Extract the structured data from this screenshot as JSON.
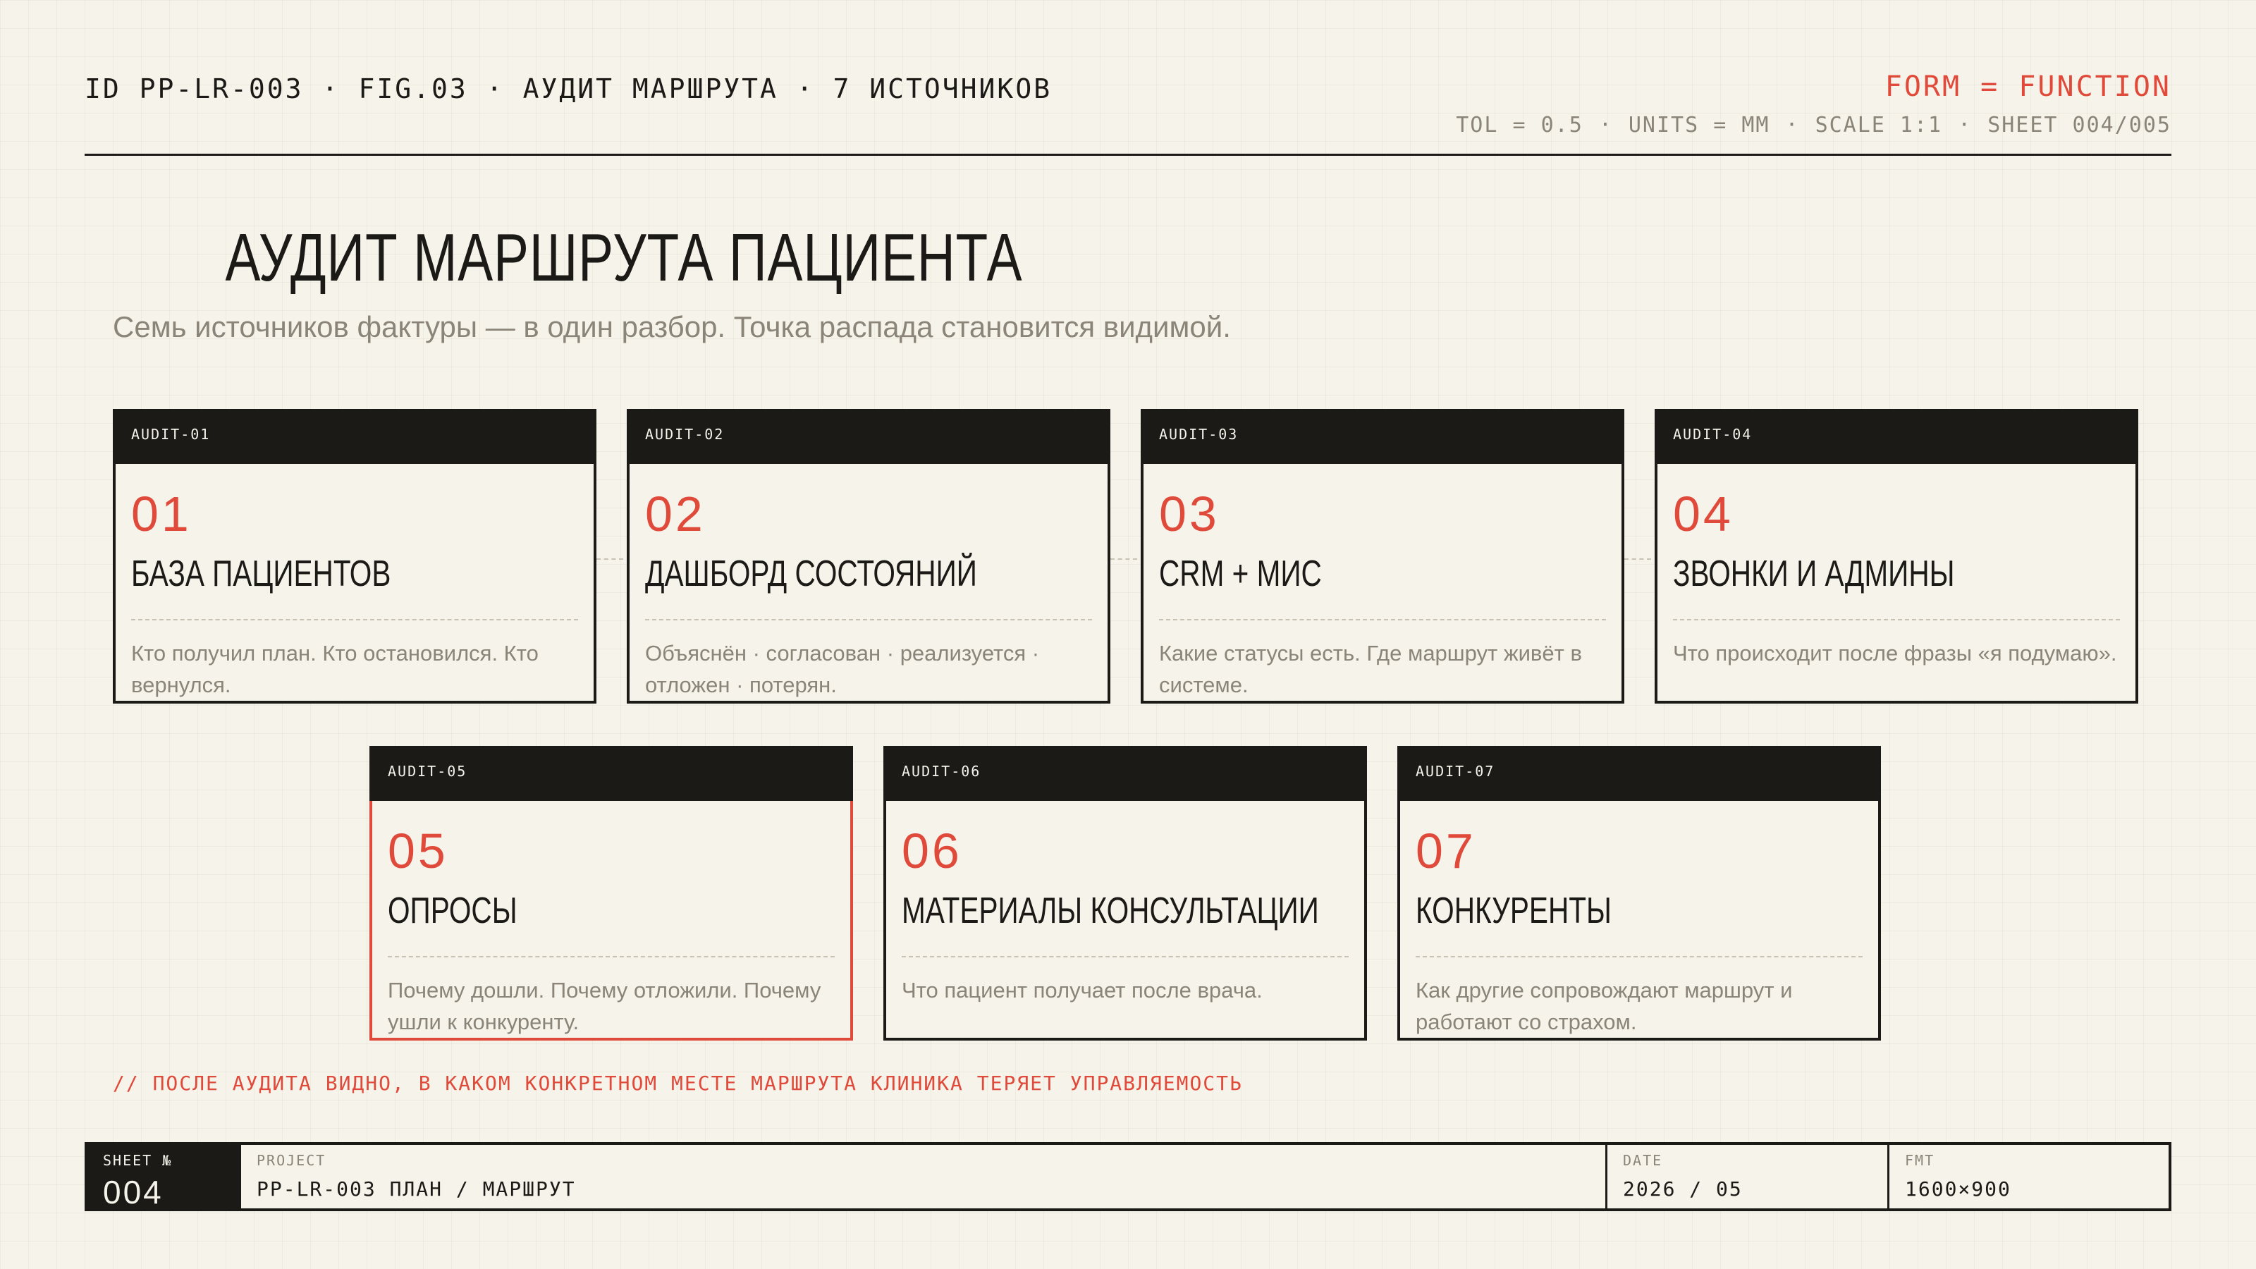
{
  "header": {
    "id": "ID PP-LR-003",
    "fig": "FIG.03",
    "caption": "АУДИТ МАРШРУТА · 7 ИСТОЧНИКОВ",
    "separator": "·",
    "form_function": "FORM = FUNCTION",
    "tol": "TOL = 0.5",
    "units": "UNITS = MM",
    "scale": "SCALE 1:1",
    "sheet": "SHEET 004/005"
  },
  "title": "АУДИТ МАРШРУТА ПАЦИЕНТА",
  "subtitle": "Семь источников фактуры — в один разбор. Точка распада становится видимой.",
  "cards": [
    {
      "code": "AUDIT-01",
      "num": "01",
      "name": "БАЗА ПАЦИЕНТОВ",
      "desc": "Кто получил план. Кто остановился. Кто вернулся."
    },
    {
      "code": "AUDIT-02",
      "num": "02",
      "name": "ДАШБОРД СОСТОЯНИЙ",
      "desc": "Объяснён · согласован · реализуется · отложен · потерян."
    },
    {
      "code": "AUDIT-03",
      "num": "03",
      "name": "CRM + МИС",
      "desc": "Какие статусы есть. Где маршрут живёт в системе."
    },
    {
      "code": "AUDIT-04",
      "num": "04",
      "name": "ЗВОНКИ И АДМИНЫ",
      "desc": "Что происходит после фразы «я подумаю»."
    },
    {
      "code": "AUDIT-05",
      "num": "05",
      "name": "ОПРОСЫ",
      "desc": "Почему дошли. Почему отложили. Почему ушли к конкуренту.",
      "highlighted": true
    },
    {
      "code": "AUDIT-06",
      "num": "06",
      "name": "МАТЕРИАЛЫ КОНСУЛЬТАЦИИ",
      "desc": "Что пациент получает после врача."
    },
    {
      "code": "AUDIT-07",
      "num": "07",
      "name": "КОНКУРЕНТЫ",
      "desc": "Как другие сопровождают маршрут и работают со страхом."
    }
  ],
  "note": "// ПОСЛЕ АУДИТА ВИДНО, В КАКОМ КОНКРЕТНОМ МЕСТЕ МАРШРУТА КЛИНИКА ТЕРЯЕТ УПРАВЛЯЕМОСТЬ",
  "footer": {
    "sheet_label": "SHEET №",
    "sheet_value": "004",
    "project_label": "PROJECT",
    "project_value": "PP-LR-003 ПЛАН / МАРШРУТ",
    "date_label": "DATE",
    "date_value": "2026 / 05",
    "fmt_label": "FMT",
    "fmt_value": "1600×900"
  },
  "colors": {
    "accent": "#e04a3a",
    "ink": "#1c1a17",
    "paper": "#f6f3ea",
    "muted": "#8a8578"
  }
}
